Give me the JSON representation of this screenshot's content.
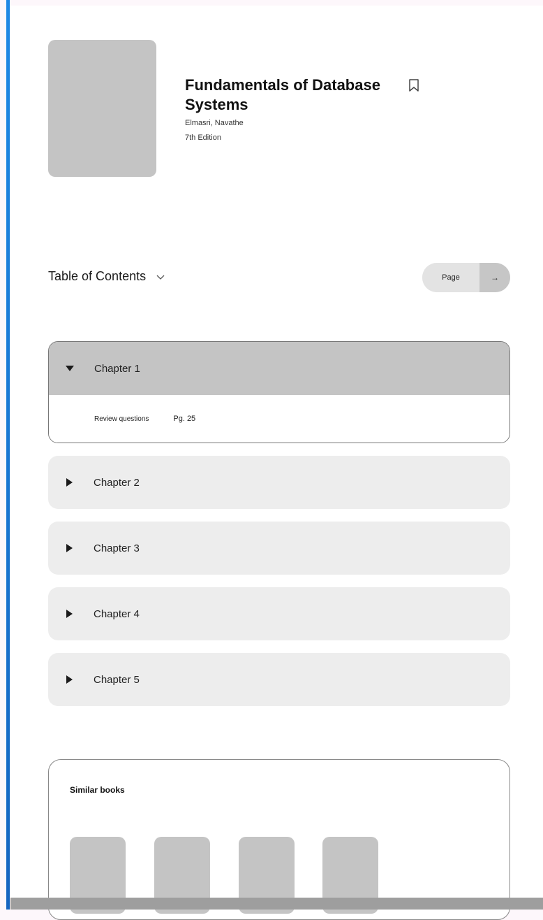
{
  "book": {
    "title": "Fundamentals of Database Systems",
    "authors": "Elmasri, Navathe",
    "edition": "7th Edition"
  },
  "toc": {
    "title": "Table of Contents",
    "page_button_label": "Page",
    "page_button_arrow": "→"
  },
  "chapters": [
    {
      "label": "Chapter 1",
      "expanded": true,
      "items": [
        {
          "label": "Review questions",
          "page": "Pg. 25"
        }
      ]
    },
    {
      "label": "Chapter 2",
      "expanded": false
    },
    {
      "label": "Chapter 3",
      "expanded": false
    },
    {
      "label": "Chapter 4",
      "expanded": false
    },
    {
      "label": "Chapter 5",
      "expanded": false
    }
  ],
  "similar": {
    "title": "Similar books"
  },
  "colors": {
    "accent_bar": "#1e88e5",
    "placeholder": "#c4c4c4",
    "chapter_bg": "#ededed"
  }
}
